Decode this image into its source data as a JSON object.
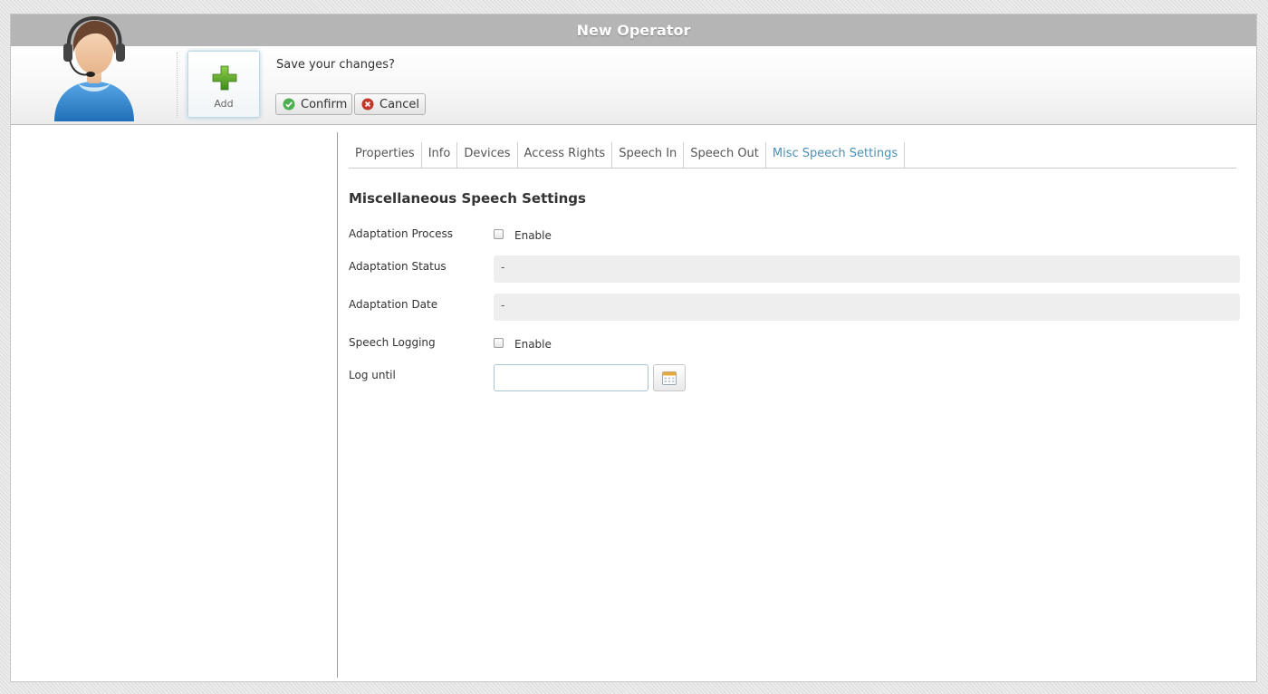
{
  "window": {
    "title": "New Operator"
  },
  "toolbar": {
    "add_label": "Add",
    "prompt": "Save your changes?",
    "confirm_label": "Confirm",
    "cancel_label": "Cancel"
  },
  "tabs": [
    {
      "label": "Properties",
      "active": false
    },
    {
      "label": "Info",
      "active": false
    },
    {
      "label": "Devices",
      "active": false
    },
    {
      "label": "Access Rights",
      "active": false
    },
    {
      "label": "Speech In",
      "active": false
    },
    {
      "label": "Speech Out",
      "active": false
    },
    {
      "label": "Misc Speech Settings",
      "active": true
    }
  ],
  "section": {
    "title": "Miscellaneous Speech Settings",
    "adaptation_process": {
      "label": "Adaptation Process",
      "checkbox_label": "Enable",
      "checked": false
    },
    "adaptation_status": {
      "label": "Adaptation Status",
      "value": "-"
    },
    "adaptation_date": {
      "label": "Adaptation Date",
      "value": "-"
    },
    "speech_logging": {
      "label": "Speech Logging",
      "checkbox_label": "Enable",
      "checked": false
    },
    "log_until": {
      "label": "Log until",
      "value": "",
      "placeholder": ""
    }
  },
  "icons": {
    "avatar": "operator-headset-avatar",
    "add": "plus-icon",
    "confirm": "check-circle-icon",
    "cancel": "x-circle-icon",
    "calendar": "calendar-icon"
  },
  "colors": {
    "titlebar": "#b5b5b5",
    "active_tab": "#4a8fb5",
    "add_icon": "#5fa32b",
    "confirm_icon": "#4caf50",
    "cancel_icon": "#c0392b"
  }
}
